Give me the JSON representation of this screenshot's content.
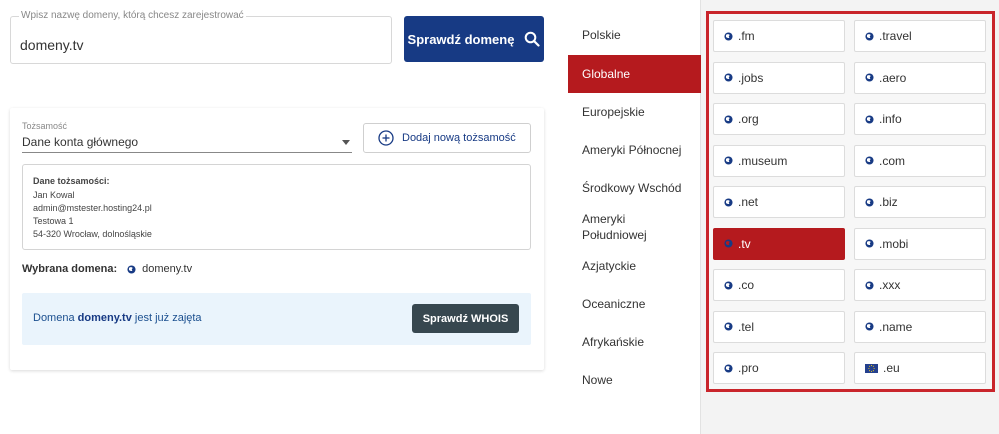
{
  "search": {
    "label": "Wpisz nazwę domeny, którą chcesz zarejestrować",
    "value": "domeny.tv",
    "button_label": "Sprawdź domenę"
  },
  "identity": {
    "label": "Tożsamość",
    "selected": "Dane konta głównego",
    "add_button_label": "Dodaj nową tożsamość",
    "details_title": "Dane tożsamości:",
    "details_lines": [
      "Jan Kowal",
      "admin@mstester.hosting24.pl",
      "Testowa 1",
      "54-320 Wrocław, dolnośląskie"
    ]
  },
  "chosen_domain": {
    "label": "Wybrana domena:",
    "value": "domeny.tv"
  },
  "alert": {
    "prefix": "Domena",
    "domain": "domeny.tv",
    "suffix": "jest już zajęta",
    "whois_label": "Sprawdź WHOIS"
  },
  "regions": [
    {
      "label": "Polskie",
      "active": false
    },
    {
      "label": "Globalne",
      "active": true
    },
    {
      "label": "Europejskie",
      "active": false
    },
    {
      "label": "Ameryki Północnej",
      "active": false
    },
    {
      "label": "Środkowy Wschód",
      "active": false
    },
    {
      "label": "Ameryki Południowej",
      "active": false
    },
    {
      "label": "Azjatyckie",
      "active": false
    },
    {
      "label": "Oceaniczne",
      "active": false
    },
    {
      "label": "Afrykańskie",
      "active": false
    },
    {
      "label": "Nowe",
      "active": false
    }
  ],
  "tlds": [
    {
      "label": ".fm",
      "icon": "globe-icon",
      "active": false
    },
    {
      "label": ".travel",
      "icon": "globe-icon",
      "active": false
    },
    {
      "label": ".jobs",
      "icon": "globe-icon",
      "active": false
    },
    {
      "label": ".aero",
      "icon": "globe-icon",
      "active": false
    },
    {
      "label": ".org",
      "icon": "globe-icon",
      "active": false
    },
    {
      "label": ".info",
      "icon": "globe-icon",
      "active": false
    },
    {
      "label": ".museum",
      "icon": "globe-icon",
      "active": false
    },
    {
      "label": ".com",
      "icon": "globe-icon",
      "active": false
    },
    {
      "label": ".net",
      "icon": "globe-icon",
      "active": false
    },
    {
      "label": ".biz",
      "icon": "globe-icon",
      "active": false
    },
    {
      "label": ".tv",
      "icon": "globe-icon",
      "active": true
    },
    {
      "label": ".mobi",
      "icon": "globe-icon",
      "active": false
    },
    {
      "label": ".co",
      "icon": "globe-icon",
      "active": false
    },
    {
      "label": ".xxx",
      "icon": "globe-icon",
      "active": false
    },
    {
      "label": ".tel",
      "icon": "globe-icon",
      "active": false
    },
    {
      "label": ".name",
      "icon": "globe-icon",
      "active": false
    },
    {
      "label": ".pro",
      "icon": "globe-icon",
      "active": false
    },
    {
      "label": ".eu",
      "icon": "eu-flag-icon",
      "active": false
    }
  ],
  "colors": {
    "primary": "#173a84",
    "accent_red": "#b51a1e",
    "highlight_frame": "#c9252b",
    "whois_button": "#37474f",
    "alert_bg": "#eaf4fc"
  }
}
